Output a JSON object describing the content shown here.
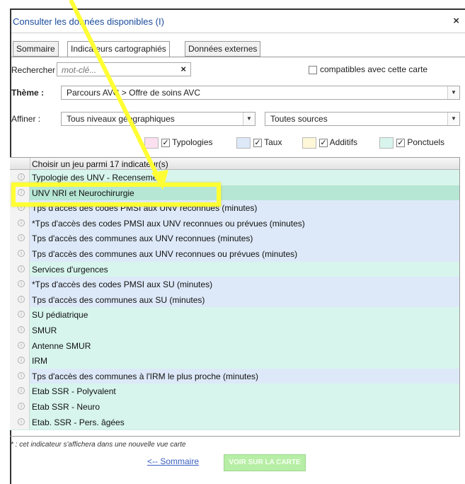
{
  "dialog": {
    "title": "Consulter les données disponibles (I)",
    "close_glyph": "×"
  },
  "tabs": [
    {
      "label": "Sommaire",
      "active": false
    },
    {
      "label": "Indicateurs cartographiés",
      "active": true
    },
    {
      "label": "Données externes",
      "active": false
    }
  ],
  "search": {
    "label": "Rechercher :",
    "placeholder": "mot-clé...",
    "clear_glyph": "×",
    "compatible_label": "compatibles avec cette carte",
    "compatible_checked": false
  },
  "theme": {
    "label": "Thème :",
    "value": "Parcours AVC > Offre de soins AVC"
  },
  "affiner": {
    "label": "Affiner :",
    "level_value": "Tous niveaux géographiques",
    "source_value": "Toutes sources"
  },
  "legend": [
    {
      "label": "Typologies",
      "color": "#fce0f0",
      "checked": true
    },
    {
      "label": "Taux",
      "color": "#dde9f8",
      "checked": true
    },
    {
      "label": "Additifs",
      "color": "#fdf7d8",
      "checked": true
    },
    {
      "label": "Ponctuels",
      "color": "#d7f5ec",
      "checked": true
    }
  ],
  "grid": {
    "header": "Choisir un jeu parmi 17 indicateur(s)",
    "rows": [
      {
        "label": "Typologie des UNV - Recensement",
        "kind": "Ponctuels"
      },
      {
        "label": "UNV NRI et Neurochirurgie",
        "kind": "Ponctuels",
        "selected": true
      },
      {
        "label": "Tps d'accès des codes PMSI aux UNV reconnues (minutes)",
        "kind": "Taux"
      },
      {
        "label": "*Tps d'accès des codes PMSI aux UNV reconnues ou prévues (minutes)",
        "kind": "Taux"
      },
      {
        "label": "Tps d'accès des communes aux UNV reconnues (minutes)",
        "kind": "Taux"
      },
      {
        "label": "Tps d'accès des communes aux UNV reconnues ou prévues (minutes)",
        "kind": "Taux"
      },
      {
        "label": "Services d'urgences",
        "kind": "Ponctuels"
      },
      {
        "label": "*Tps d'accès des codes PMSI aux SU (minutes)",
        "kind": "Taux"
      },
      {
        "label": "Tps d'accès des communes aux SU (minutes)",
        "kind": "Taux"
      },
      {
        "label": "SU pédiatrique",
        "kind": "Ponctuels"
      },
      {
        "label": "SMUR",
        "kind": "Ponctuels"
      },
      {
        "label": "Antenne SMUR",
        "kind": "Ponctuels"
      },
      {
        "label": "IRM",
        "kind": "Ponctuels"
      },
      {
        "label": "Tps d'accès des communes à l'IRM le plus proche (minutes)",
        "kind": "Taux"
      },
      {
        "label": "Etab SSR - Polyvalent",
        "kind": "Ponctuels"
      },
      {
        "label": "Etab SSR - Neuro",
        "kind": "Ponctuels"
      },
      {
        "label": "Etab. SSR - Pers. âgées",
        "kind": "Ponctuels"
      }
    ]
  },
  "footer": {
    "note": "* : cet indicateur s'affichera dans une nouvelle vue carte",
    "back_link": "<-- Sommaire",
    "map_button": "VOIR SUR LA CARTE"
  },
  "annotation": {
    "highlight_color": "#ffff33"
  }
}
